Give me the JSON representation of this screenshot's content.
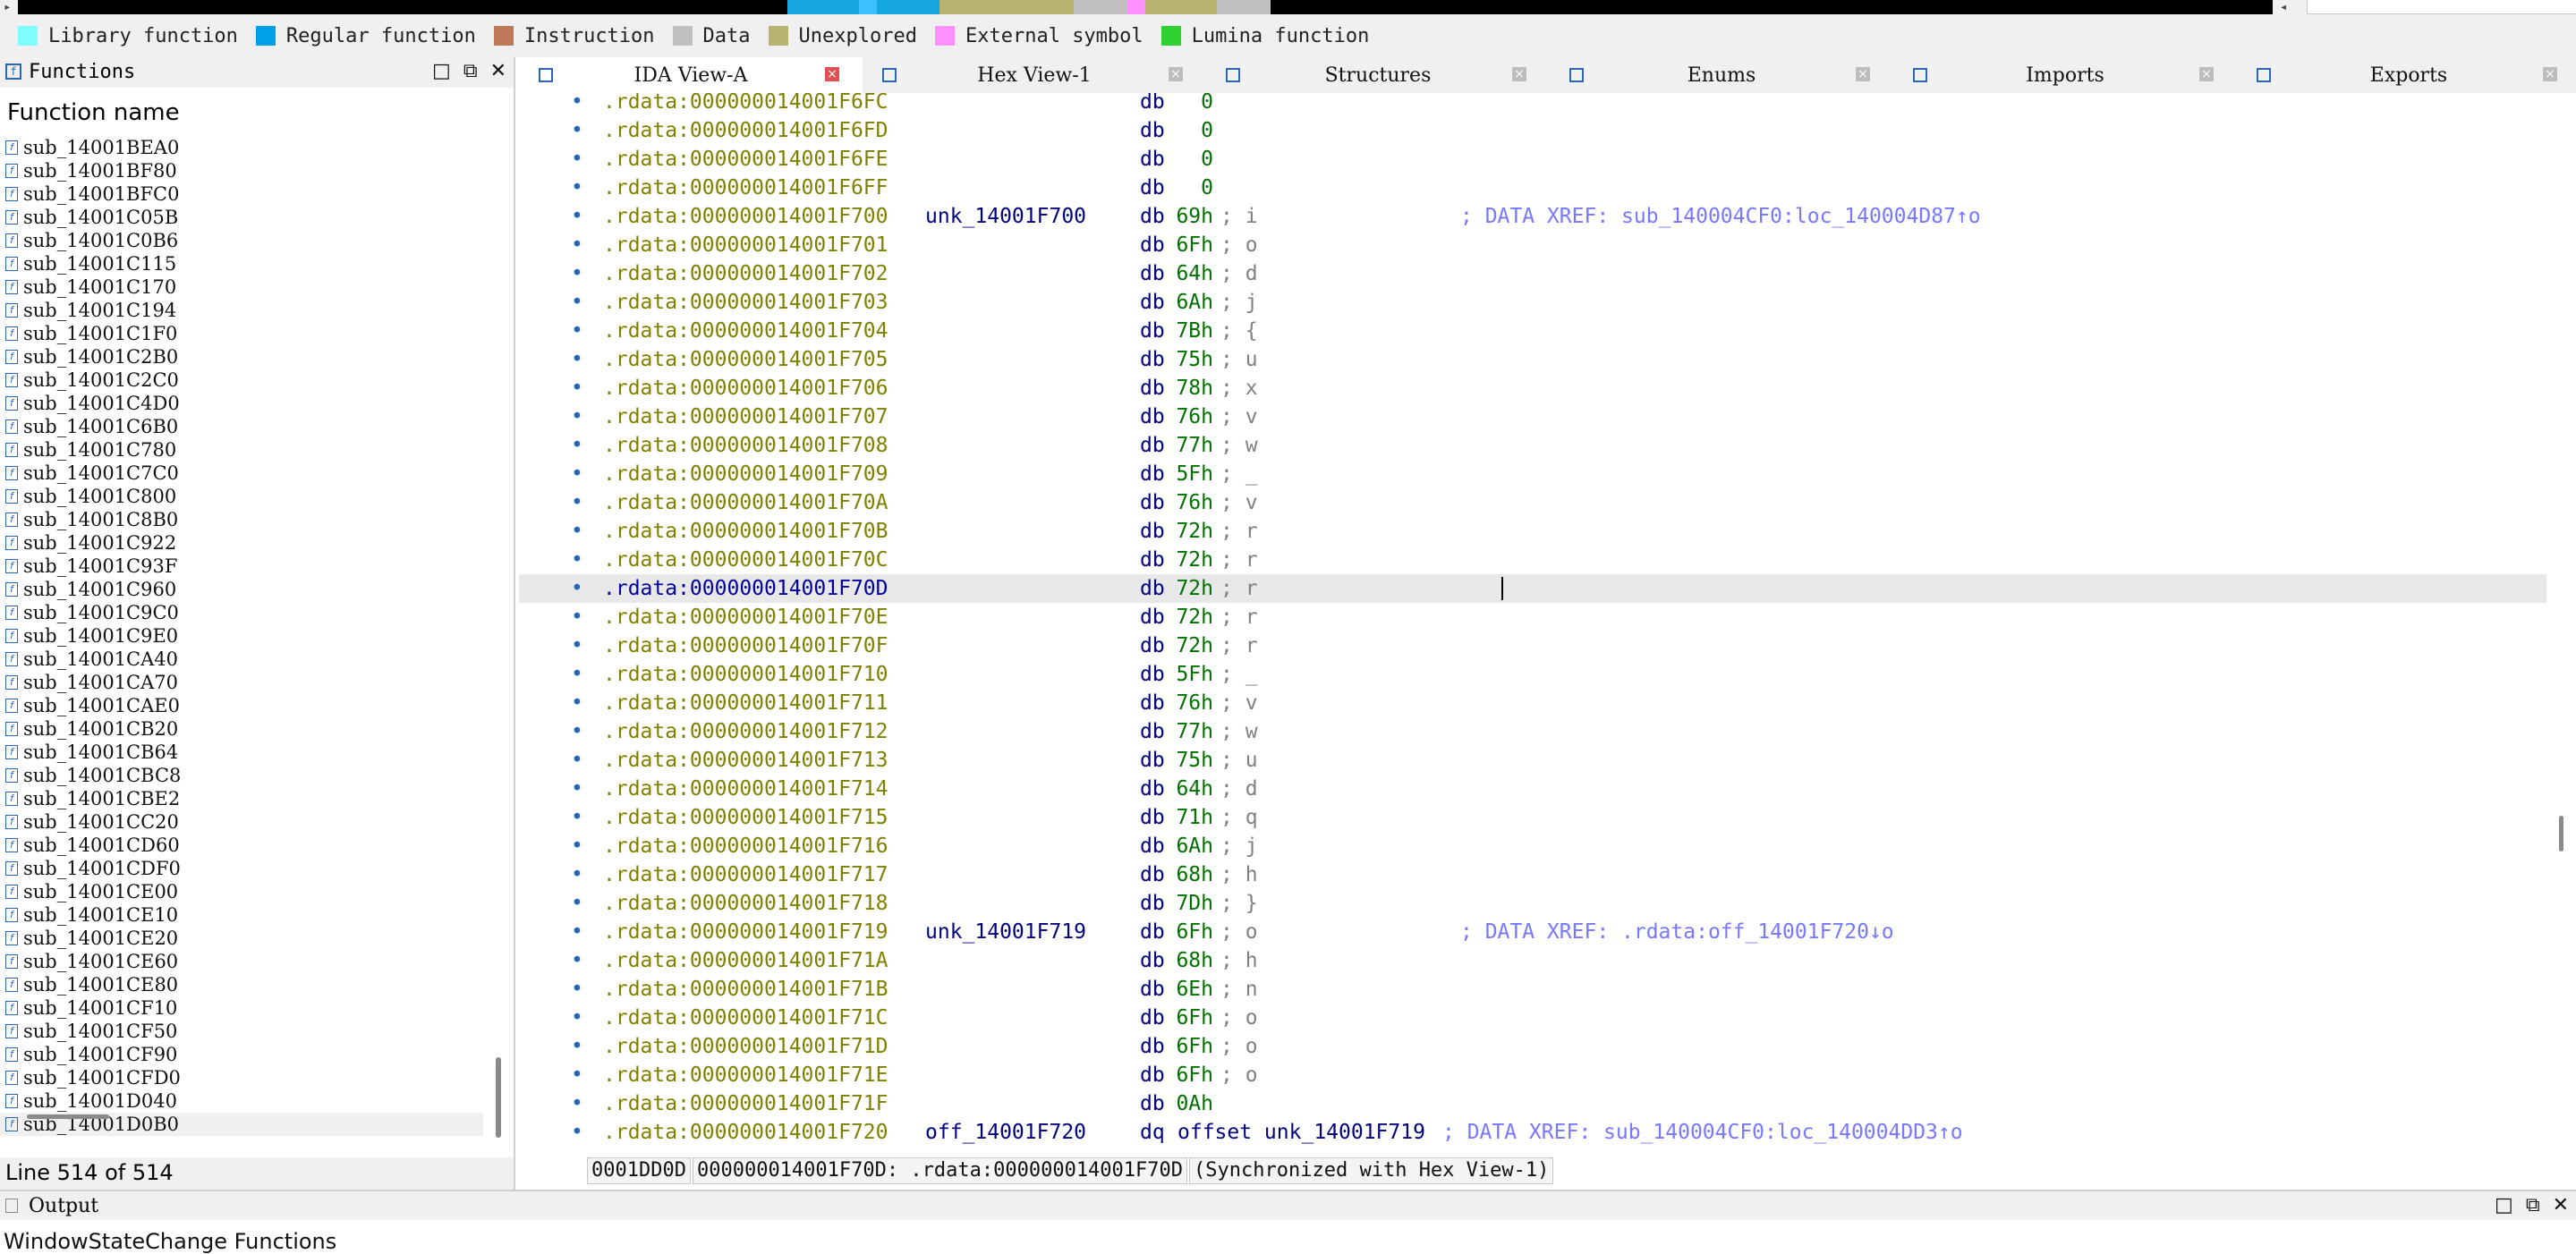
{
  "navigator": {
    "left_arrow": "▸",
    "right_arrow": "◂",
    "segments": [
      {
        "color": "#16a7e0",
        "start": 0.335,
        "end": 0.335
      },
      {
        "color": "#16a7e0",
        "start": 0.0,
        "end": 0.0
      }
    ]
  },
  "legend": [
    {
      "label": "Library function",
      "color": "#80ffff"
    },
    {
      "label": "Regular function",
      "color": "#00a0e8"
    },
    {
      "label": "Instruction",
      "color": "#c0785a"
    },
    {
      "label": "Data",
      "color": "#c0c0c0"
    },
    {
      "label": "Unexplored",
      "color": "#b8b470"
    },
    {
      "label": "External symbol",
      "color": "#ff90ff"
    },
    {
      "label": "Lumina function",
      "color": "#30d030"
    }
  ],
  "functions_panel": {
    "title": "Functions",
    "column_header": "Function name",
    "status": "Line 514 of 514",
    "buttons": {
      "maximize": "□",
      "restore": "⧉",
      "close": "✕"
    },
    "items": [
      "sub_14001BEA0",
      "sub_14001BF80",
      "sub_14001BFC0",
      "sub_14001C05B",
      "sub_14001C0B6",
      "sub_14001C115",
      "sub_14001C170",
      "sub_14001C194",
      "sub_14001C1F0",
      "sub_14001C2B0",
      "sub_14001C2C0",
      "sub_14001C4D0",
      "sub_14001C6B0",
      "sub_14001C780",
      "sub_14001C7C0",
      "sub_14001C800",
      "sub_14001C8B0",
      "sub_14001C922",
      "sub_14001C93F",
      "sub_14001C960",
      "sub_14001C9C0",
      "sub_14001C9E0",
      "sub_14001CA40",
      "sub_14001CA70",
      "sub_14001CAE0",
      "sub_14001CB20",
      "sub_14001CB64",
      "sub_14001CBC8",
      "sub_14001CBE2",
      "sub_14001CC20",
      "sub_14001CD60",
      "sub_14001CDF0",
      "sub_14001CE00",
      "sub_14001CE10",
      "sub_14001CE20",
      "sub_14001CE60",
      "sub_14001CE80",
      "sub_14001CF10",
      "sub_14001CF50",
      "sub_14001CF90",
      "sub_14001CFD0",
      "sub_14001D040",
      "sub_14001D0B0"
    ],
    "selected_index": 42
  },
  "tabs": [
    {
      "label": "IDA View-A",
      "active": true,
      "icon": "ida-view-icon"
    },
    {
      "label": "Hex View-1",
      "active": false,
      "icon": "hex-view-icon"
    },
    {
      "label": "Structures",
      "active": false,
      "icon": "structures-icon"
    },
    {
      "label": "Enums",
      "active": false,
      "icon": "enums-icon"
    },
    {
      "label": "Imports",
      "active": false,
      "icon": "imports-icon"
    },
    {
      "label": "Exports",
      "active": false,
      "icon": "exports-icon"
    }
  ],
  "disassembly": {
    "current_row": 17,
    "rows": [
      {
        "addr": ".rdata:000000014001F6FC",
        "label": "",
        "mnem": "db",
        "op": "0",
        "cmt": "",
        "xref": ""
      },
      {
        "addr": ".rdata:000000014001F6FD",
        "label": "",
        "mnem": "db",
        "op": "0",
        "cmt": "",
        "xref": ""
      },
      {
        "addr": ".rdata:000000014001F6FE",
        "label": "",
        "mnem": "db",
        "op": "0",
        "cmt": "",
        "xref": ""
      },
      {
        "addr": ".rdata:000000014001F6FF",
        "label": "",
        "mnem": "db",
        "op": "0",
        "cmt": "",
        "xref": ""
      },
      {
        "addr": ".rdata:000000014001F700",
        "label": "unk_14001F700",
        "mnem": "db",
        "op": "69h",
        "cmt": "; i",
        "xref": "; DATA XREF: sub_140004CF0:loc_140004D87↑o"
      },
      {
        "addr": ".rdata:000000014001F701",
        "label": "",
        "mnem": "db",
        "op": "6Fh",
        "cmt": "; o",
        "xref": ""
      },
      {
        "addr": ".rdata:000000014001F702",
        "label": "",
        "mnem": "db",
        "op": "64h",
        "cmt": "; d",
        "xref": ""
      },
      {
        "addr": ".rdata:000000014001F703",
        "label": "",
        "mnem": "db",
        "op": "6Ah",
        "cmt": "; j",
        "xref": ""
      },
      {
        "addr": ".rdata:000000014001F704",
        "label": "",
        "mnem": "db",
        "op": "7Bh",
        "cmt": "; {",
        "xref": ""
      },
      {
        "addr": ".rdata:000000014001F705",
        "label": "",
        "mnem": "db",
        "op": "75h",
        "cmt": "; u",
        "xref": ""
      },
      {
        "addr": ".rdata:000000014001F706",
        "label": "",
        "mnem": "db",
        "op": "78h",
        "cmt": "; x",
        "xref": ""
      },
      {
        "addr": ".rdata:000000014001F707",
        "label": "",
        "mnem": "db",
        "op": "76h",
        "cmt": "; v",
        "xref": ""
      },
      {
        "addr": ".rdata:000000014001F708",
        "label": "",
        "mnem": "db",
        "op": "77h",
        "cmt": "; w",
        "xref": ""
      },
      {
        "addr": ".rdata:000000014001F709",
        "label": "",
        "mnem": "db",
        "op": "5Fh",
        "cmt": "; _",
        "xref": ""
      },
      {
        "addr": ".rdata:000000014001F70A",
        "label": "",
        "mnem": "db",
        "op": "76h",
        "cmt": "; v",
        "xref": ""
      },
      {
        "addr": ".rdata:000000014001F70B",
        "label": "",
        "mnem": "db",
        "op": "72h",
        "cmt": "; r",
        "xref": ""
      },
      {
        "addr": ".rdata:000000014001F70C",
        "label": "",
        "mnem": "db",
        "op": "72h",
        "cmt": "; r",
        "xref": ""
      },
      {
        "addr": ".rdata:000000014001F70D",
        "label": "",
        "mnem": "db",
        "op": "72h",
        "cmt": "; r",
        "xref": ""
      },
      {
        "addr": ".rdata:000000014001F70E",
        "label": "",
        "mnem": "db",
        "op": "72h",
        "cmt": "; r",
        "xref": ""
      },
      {
        "addr": ".rdata:000000014001F70F",
        "label": "",
        "mnem": "db",
        "op": "72h",
        "cmt": "; r",
        "xref": ""
      },
      {
        "addr": ".rdata:000000014001F710",
        "label": "",
        "mnem": "db",
        "op": "5Fh",
        "cmt": "; _",
        "xref": ""
      },
      {
        "addr": ".rdata:000000014001F711",
        "label": "",
        "mnem": "db",
        "op": "76h",
        "cmt": "; v",
        "xref": ""
      },
      {
        "addr": ".rdata:000000014001F712",
        "label": "",
        "mnem": "db",
        "op": "77h",
        "cmt": "; w",
        "xref": ""
      },
      {
        "addr": ".rdata:000000014001F713",
        "label": "",
        "mnem": "db",
        "op": "75h",
        "cmt": "; u",
        "xref": ""
      },
      {
        "addr": ".rdata:000000014001F714",
        "label": "",
        "mnem": "db",
        "op": "64h",
        "cmt": "; d",
        "xref": ""
      },
      {
        "addr": ".rdata:000000014001F715",
        "label": "",
        "mnem": "db",
        "op": "71h",
        "cmt": "; q",
        "xref": ""
      },
      {
        "addr": ".rdata:000000014001F716",
        "label": "",
        "mnem": "db",
        "op": "6Ah",
        "cmt": "; j",
        "xref": ""
      },
      {
        "addr": ".rdata:000000014001F717",
        "label": "",
        "mnem": "db",
        "op": "68h",
        "cmt": "; h",
        "xref": ""
      },
      {
        "addr": ".rdata:000000014001F718",
        "label": "",
        "mnem": "db",
        "op": "7Dh",
        "cmt": "; }",
        "xref": ""
      },
      {
        "addr": ".rdata:000000014001F719",
        "label": "unk_14001F719",
        "mnem": "db",
        "op": "6Fh",
        "cmt": "; o",
        "xref": "; DATA XREF: .rdata:off_14001F720↓o"
      },
      {
        "addr": ".rdata:000000014001F71A",
        "label": "",
        "mnem": "db",
        "op": "68h",
        "cmt": "; h",
        "xref": ""
      },
      {
        "addr": ".rdata:000000014001F71B",
        "label": "",
        "mnem": "db",
        "op": "6Eh",
        "cmt": "; n",
        "xref": ""
      },
      {
        "addr": ".rdata:000000014001F71C",
        "label": "",
        "mnem": "db",
        "op": "6Fh",
        "cmt": "; o",
        "xref": ""
      },
      {
        "addr": ".rdata:000000014001F71D",
        "label": "",
        "mnem": "db",
        "op": "6Fh",
        "cmt": "; o",
        "xref": ""
      },
      {
        "addr": ".rdata:000000014001F71E",
        "label": "",
        "mnem": "db",
        "op": "6Fh",
        "cmt": "; o",
        "xref": ""
      },
      {
        "addr": ".rdata:000000014001F71F",
        "label": "",
        "mnem": "db",
        "op": "0Ah",
        "cmt": "",
        "xref": ""
      },
      {
        "addr": ".rdata:000000014001F720",
        "label": "off_14001F720",
        "mnem": "dq",
        "op": "offset unk_14001F719",
        "cmt": "",
        "xref": "; DATA XREF: sub_140004CF0:loc_140004DD3↑o"
      }
    ]
  },
  "ida_status": [
    "0001DD0D",
    "000000014001F70D: .rdata:000000014001F70D",
    "(Synchronized with Hex View-1)"
  ],
  "output_panel": {
    "title": "Output",
    "text": "WindowStateChange Functions",
    "buttons": {
      "maximize": "□",
      "restore": "⧉",
      "close": "✕"
    }
  }
}
